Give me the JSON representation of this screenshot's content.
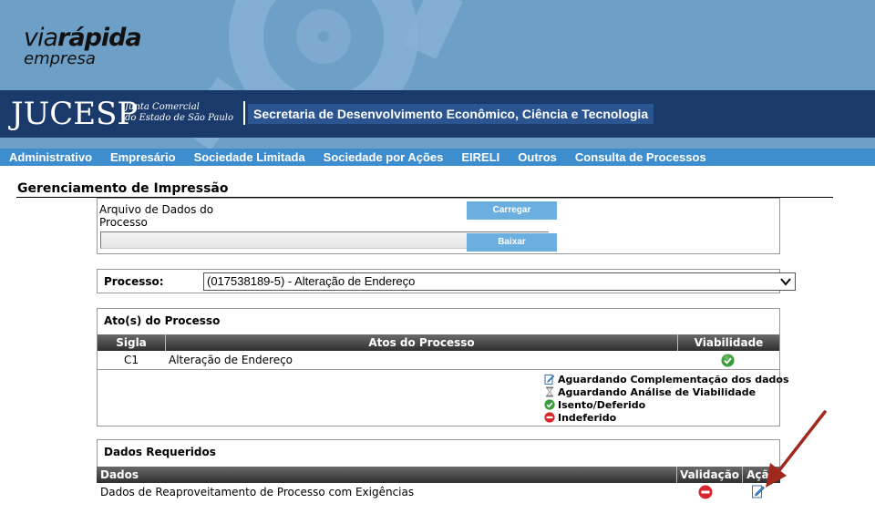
{
  "branding": {
    "logo_via": "via",
    "logo_rapida": "rápida",
    "logo_empresa": "empresa",
    "jucesp": "JUCESP",
    "jucesp_sub_line1": "Junta Comercial",
    "jucesp_sub_line2": "do Estado de São Paulo",
    "secretaria": "Secretaria de Desenvolvimento Econômico, Ciência e Tecnologia"
  },
  "nav": {
    "items": [
      {
        "label": "Administrativo"
      },
      {
        "label": "Empresário"
      },
      {
        "label": "Sociedade Limitada"
      },
      {
        "label": "Sociedade por Ações"
      },
      {
        "label": "EIRELI"
      },
      {
        "label": "Outros"
      },
      {
        "label": "Consulta de Processos"
      }
    ]
  },
  "page": {
    "title": "Gerenciamento de Impressão"
  },
  "upload": {
    "label": "Arquivo de Dados do Processo",
    "carregar_label": "Carregar",
    "baixar_label": "Baixar"
  },
  "processo": {
    "label": "Processo:",
    "selected": "(017538189-5) - Alteração de Endereço"
  },
  "atos": {
    "heading": "Ato(s) do Processo",
    "columns": [
      "Sigla",
      "Atos do Processo",
      "Viabilidade"
    ],
    "rows": [
      {
        "sigla": "C1",
        "ato": "Alteração de Endereço",
        "viabilidade_icon": "check-circle-icon"
      }
    ],
    "legend": [
      {
        "icon": "edit-document-icon",
        "label": "Aguardando Complementação dos dados"
      },
      {
        "icon": "hourglass-icon",
        "label": "Aguardando Análise de Viabilidade"
      },
      {
        "icon": "check-circle-icon",
        "label": "Isento/Deferido"
      },
      {
        "icon": "no-entry-icon",
        "label": "Indeferido"
      }
    ]
  },
  "dados": {
    "heading": "Dados Requeridos",
    "columns": [
      "Dados",
      "Validação",
      "Ação"
    ],
    "rows": [
      {
        "dado": "Dados de Reaproveitamento de Processo com Exigências",
        "validacao_icon": "no-entry-icon",
        "acao_icon": "edit-document-icon"
      }
    ]
  },
  "colors": {
    "header_bg": "#6e9fc6",
    "jucesp_band": "#1a3a6b",
    "nav_bg": "#3d8dcf",
    "button_bg": "#6baee0",
    "arrow": "#a0281e"
  }
}
